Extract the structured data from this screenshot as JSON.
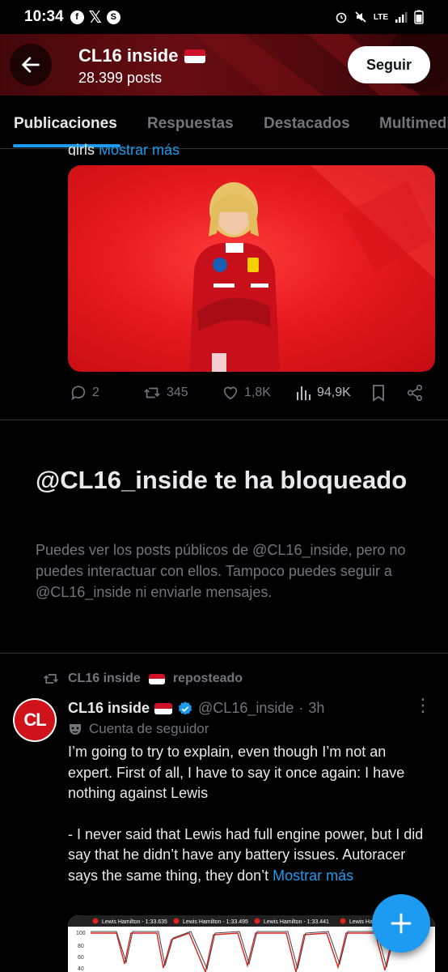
{
  "status_bar": {
    "time": "10:34",
    "network": "LTE"
  },
  "header": {
    "title": "CL16 inside",
    "posts_count": "28.399 posts",
    "follow_label": "Seguir"
  },
  "tabs": [
    {
      "label": "Publicaciones",
      "active": true
    },
    {
      "label": "Respuestas",
      "active": false
    },
    {
      "label": "Destacados",
      "active": false
    },
    {
      "label": "Multimedia",
      "active": false
    }
  ],
  "previous_post": {
    "text_fragment": "girls",
    "more_label": "Mostrar más",
    "actions": {
      "replies": "2",
      "reposts": "345",
      "likes": "1,8K",
      "views": "94,9K"
    }
  },
  "blocked": {
    "title": "@CL16_inside te ha bloqueado",
    "description": "Puedes ver los posts públicos de @CL16_inside, pero no puedes interactuar con ellos. Tampoco puedes seguir a @CL16_inside ni enviarle mensajes."
  },
  "repost": {
    "reposted_by": "CL16 inside",
    "reposted_label": "reposteado",
    "author_name": "CL16 inside",
    "author_handle": "@CL16_inside",
    "time": "3h",
    "follower_label": "Cuenta de seguidor",
    "avatar_text": "CL",
    "body_p1": "I’m going to try to explain, even though I’m not an expert. First of all, I have to say it once again: I have nothing against Lewis",
    "body_p2": "- I never said that Lewis had full engine power, but I did say that he didn’t have any battery issues. Autoracer says the same thing, they don’t",
    "more_label": "Mostrar más"
  },
  "chart_preview": {
    "series_labels": [
      "Lewis Hamilton - 1:33.635",
      "Lewis Hamilton - 1:33.495",
      "Lewis Hamilton - 1:33.441",
      "Lewis Ham"
    ],
    "y_ticks": [
      "100",
      "80",
      "60",
      "40"
    ]
  },
  "colors": {
    "accent": "#1d9bf0",
    "muted": "#71767b",
    "text": "#e7e9ea",
    "background": "#000000"
  }
}
